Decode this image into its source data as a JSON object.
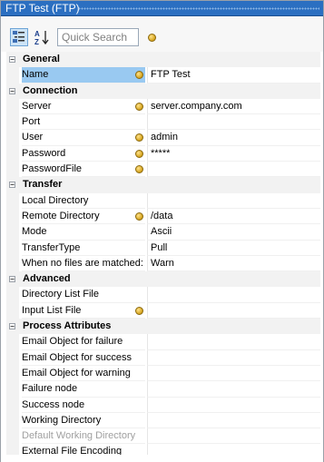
{
  "window": {
    "title": "FTP Test (FTP)"
  },
  "toolbar": {
    "categorized_icon": "categorized-view-icon",
    "alphabetical_icon": "sort-alphabetical-icon",
    "search_placeholder": "Quick Search",
    "parameter_icon": "parameter-coin-icon"
  },
  "colors": {
    "title_bar": "#2b6fc1",
    "selection": "#99c9f1",
    "category_bg": "#f2f2f2",
    "coin": "#d4a21a"
  },
  "groups": [
    {
      "label": "General",
      "rows": [
        {
          "name": "Name",
          "value": "FTP Test",
          "coin": true,
          "selected": true
        }
      ]
    },
    {
      "label": "Connection",
      "rows": [
        {
          "name": "Server",
          "value": "server.company.com",
          "coin": true
        },
        {
          "name": "Port",
          "value": ""
        },
        {
          "name": "User",
          "value": "admin",
          "coin": true
        },
        {
          "name": "Password",
          "value": "*****",
          "coin": true
        },
        {
          "name": "PasswordFile",
          "value": "",
          "coin": true
        }
      ]
    },
    {
      "label": "Transfer",
      "rows": [
        {
          "name": "Local Directory",
          "value": ""
        },
        {
          "name": "Remote Directory",
          "value": "/data",
          "coin": true
        },
        {
          "name": "Mode",
          "value": "Ascii"
        },
        {
          "name": "TransferType",
          "value": "Pull"
        },
        {
          "name": "When no files are matched:",
          "value": "Warn"
        }
      ]
    },
    {
      "label": "Advanced",
      "rows": [
        {
          "name": "Directory List File",
          "value": ""
        },
        {
          "name": "Input List File",
          "value": "",
          "coin": true
        }
      ]
    },
    {
      "label": "Process Attributes",
      "rows": [
        {
          "name": "Email Object for failure",
          "value": ""
        },
        {
          "name": "Email Object for success",
          "value": ""
        },
        {
          "name": "Email Object for warning",
          "value": ""
        },
        {
          "name": "Failure node",
          "value": ""
        },
        {
          "name": "Success node",
          "value": ""
        },
        {
          "name": "Working Directory",
          "value": ""
        },
        {
          "name": "Default Working Directory",
          "value": "",
          "disabled": true
        },
        {
          "name": "External File Encoding",
          "value": ""
        }
      ]
    }
  ]
}
